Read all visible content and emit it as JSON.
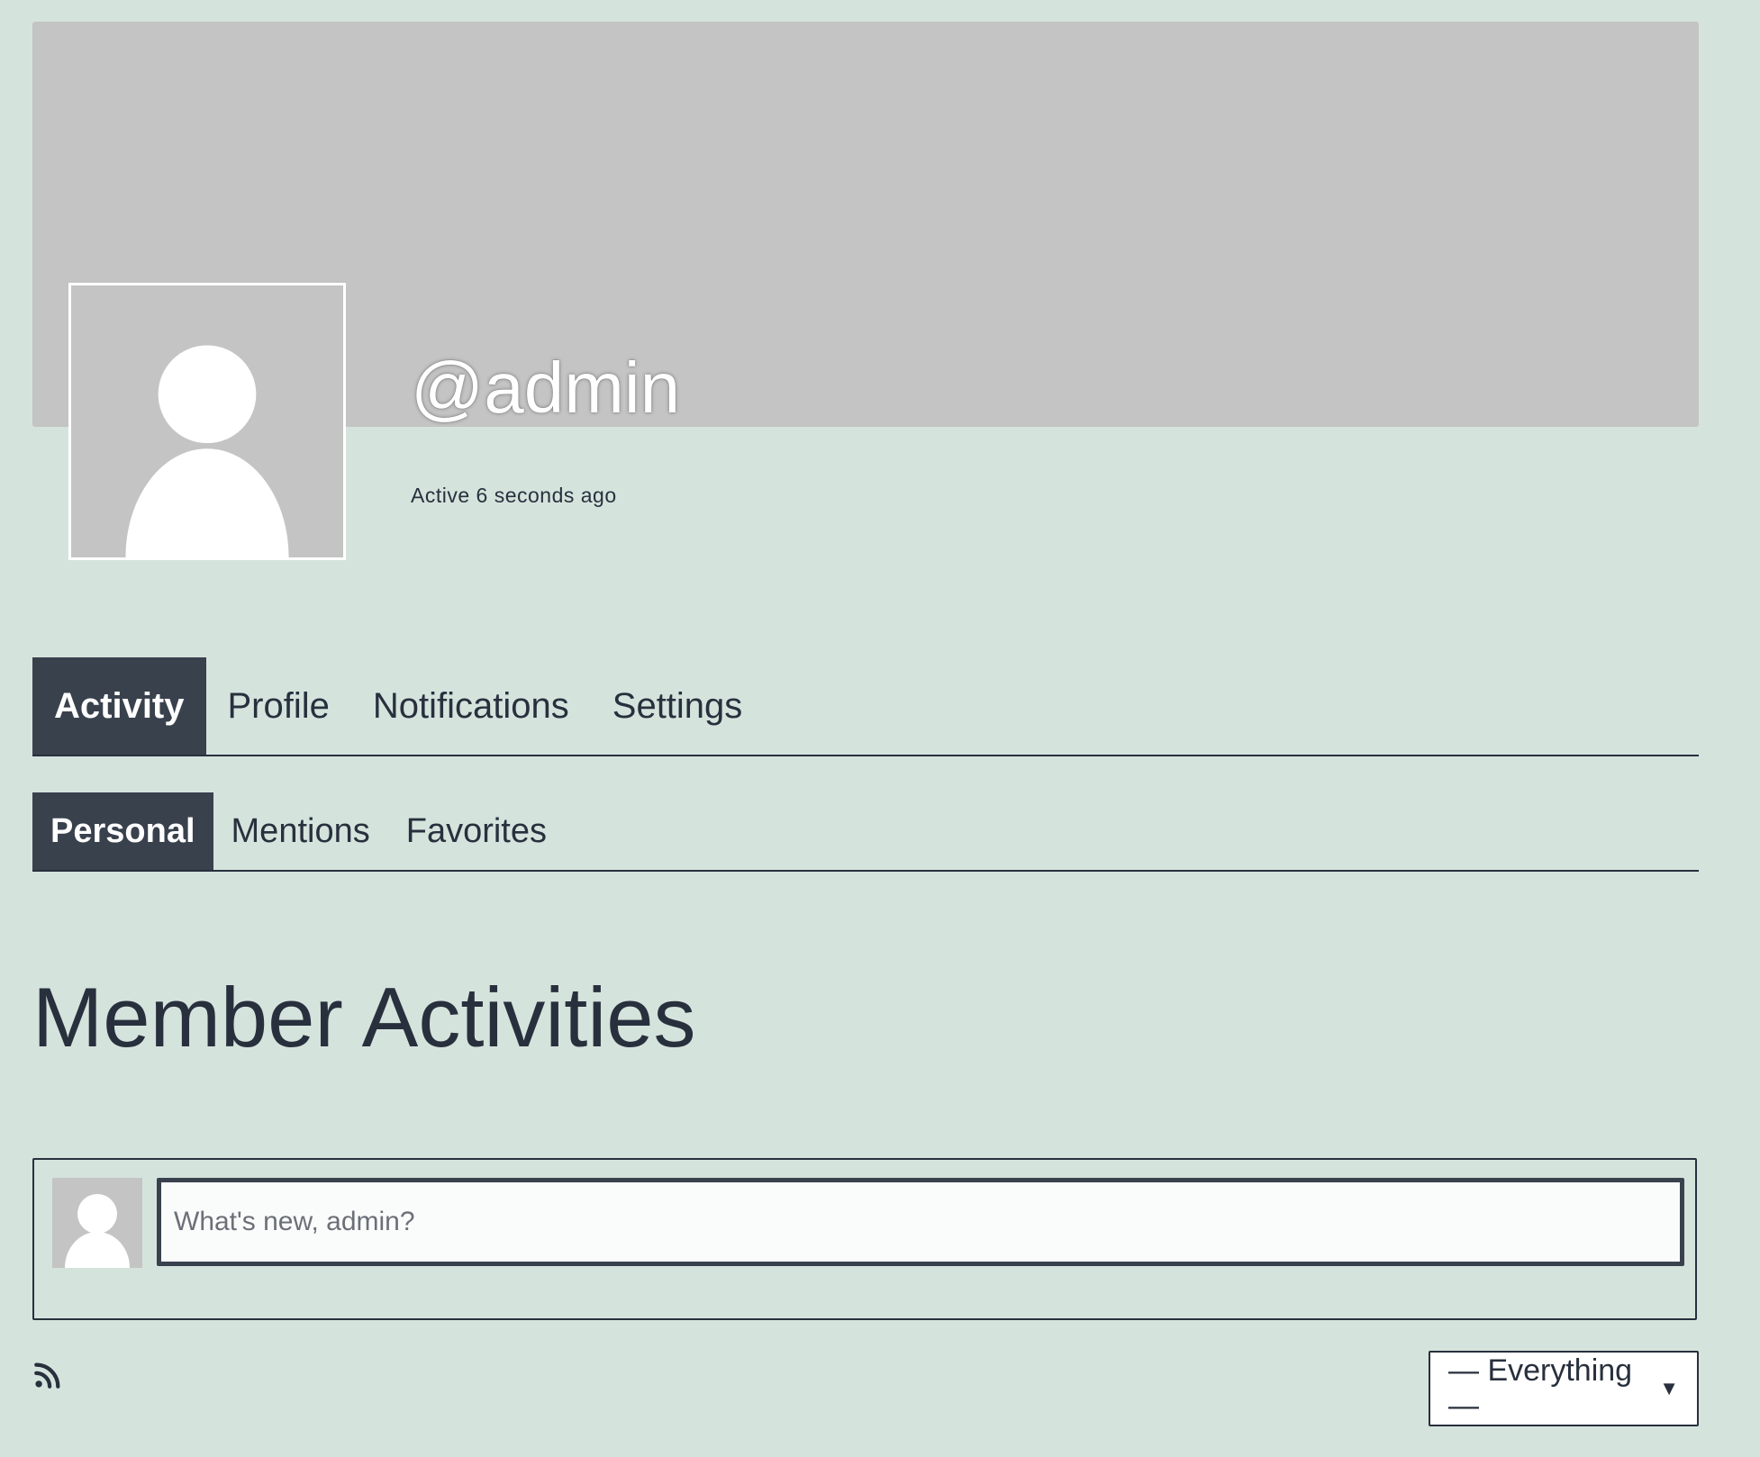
{
  "profile": {
    "username": "@admin",
    "activity_status": "Active 6 seconds ago"
  },
  "primary_nav": {
    "items": [
      {
        "label": "Activity",
        "active": true
      },
      {
        "label": "Profile",
        "active": false
      },
      {
        "label": "Notifications",
        "active": false
      },
      {
        "label": "Settings",
        "active": false
      }
    ]
  },
  "secondary_nav": {
    "items": [
      {
        "label": "Personal",
        "active": true
      },
      {
        "label": "Mentions",
        "active": false
      },
      {
        "label": "Favorites",
        "active": false
      }
    ]
  },
  "main": {
    "title": "Member Activities"
  },
  "post_form": {
    "placeholder": "What's new, admin?",
    "value": ""
  },
  "filter": {
    "selected": "— Everything —"
  },
  "icons": {
    "rss": "rss-feed-icon",
    "select_arrow": "caret-down-icon",
    "avatar": "default-avatar-icon"
  },
  "colors": {
    "page_background": "#d5e3dd",
    "cover_background": "#c4c4c4",
    "active_tab_background": "#39414d",
    "text": "#28303d"
  }
}
